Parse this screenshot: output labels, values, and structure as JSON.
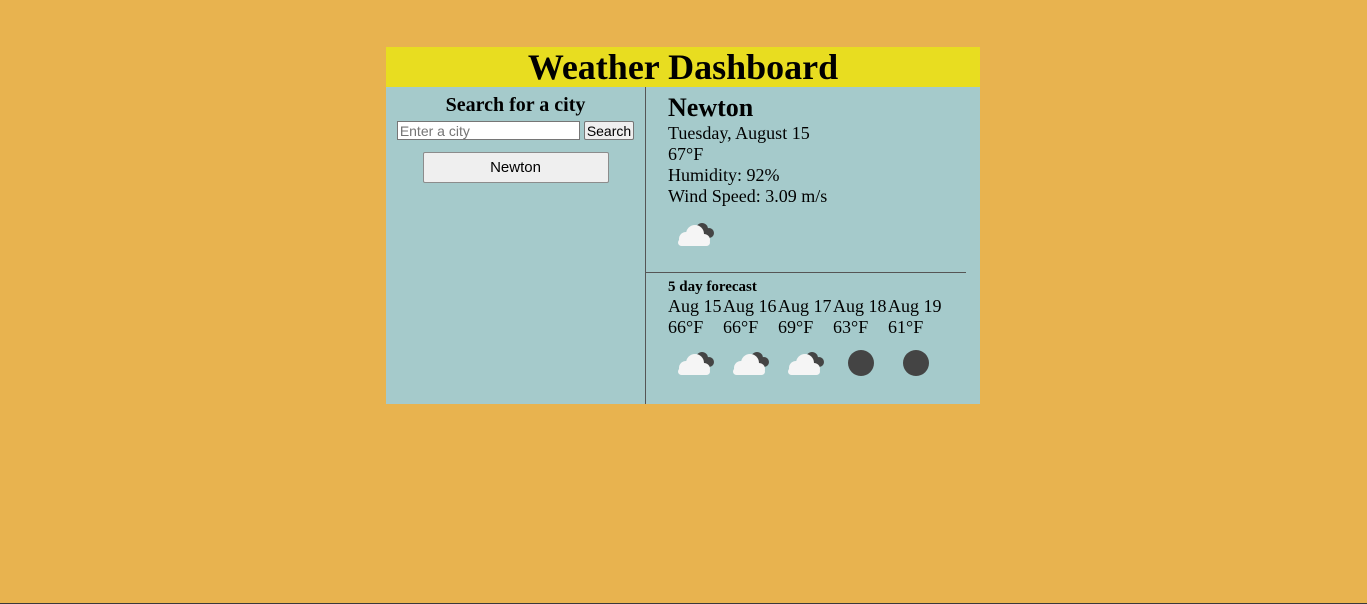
{
  "header": {
    "title": "Weather Dashboard"
  },
  "search": {
    "title": "Search for a city",
    "placeholder": "Enter a city",
    "value": "",
    "button_label": "Search"
  },
  "history": [
    {
      "label": "Newton"
    }
  ],
  "current": {
    "city": "Newton",
    "date": "Tuesday, August 15",
    "temp": "67°F",
    "humidity": "Humidity: 92%",
    "wind": "Wind Speed: 3.09 m/s",
    "icon": "cloudy-night-icon"
  },
  "forecast": {
    "title": "5 day forecast",
    "days": [
      {
        "date": "Aug 15",
        "temp": "66°F",
        "icon": "cloudy-night-icon"
      },
      {
        "date": "Aug 16",
        "temp": "66°F",
        "icon": "cloudy-night-icon"
      },
      {
        "date": "Aug 17",
        "temp": "69°F",
        "icon": "cloudy-night-icon"
      },
      {
        "date": "Aug 18",
        "temp": "63°F",
        "icon": "moon-icon"
      },
      {
        "date": "Aug 19",
        "temp": "61°F",
        "icon": "moon-icon"
      }
    ]
  },
  "colors": {
    "background": "#e8b34f",
    "header": "#e8dd20",
    "panel": "#a5cacb"
  }
}
